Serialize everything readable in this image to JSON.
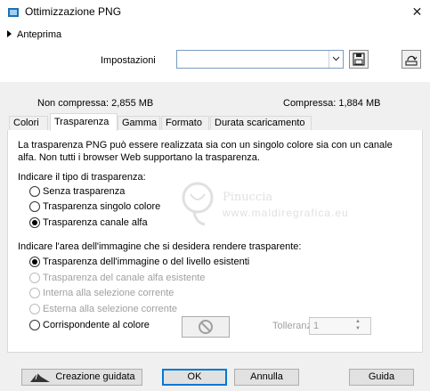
{
  "window": {
    "title": "Ottimizzazione PNG",
    "close_glyph": "✕"
  },
  "preview": {
    "label": "Anteprima"
  },
  "settings": {
    "label": "Impostazioni",
    "value": ""
  },
  "sizes": {
    "uncompressed_label": "Non compressa:",
    "uncompressed_value": "2,855 MB",
    "compressed_label": "Compressa:",
    "compressed_value": "1,884 MB"
  },
  "tabs": [
    {
      "label": "Colori"
    },
    {
      "label": "Trasparenza",
      "active": true
    },
    {
      "label": "Gamma"
    },
    {
      "label": "Formato"
    },
    {
      "label": "Durata scaricamento"
    }
  ],
  "panel": {
    "description": "La trasparenza PNG può essere realizzata sia con un singolo colore sia con un canale alfa. Non tutti i browser Web supportano la trasparenza.",
    "type_heading": "Indicare il tipo di trasparenza:",
    "type_options": [
      {
        "label": "Senza trasparenza",
        "checked": false
      },
      {
        "label": "Trasparenza singolo colore",
        "checked": false
      },
      {
        "label": "Trasparenza canale alfa",
        "checked": true
      }
    ],
    "area_heading": "Indicare l'area dell'immagine che si desidera rendere trasparente:",
    "area_options": [
      {
        "label": "Trasparenza dell'immagine o del livello esistenti",
        "checked": true,
        "enabled": true
      },
      {
        "label": "Trasparenza del canale alfa esistente",
        "checked": false,
        "enabled": false
      },
      {
        "label": "Interna alla selezione corrente",
        "checked": false,
        "enabled": false
      },
      {
        "label": "Esterna alla selezione corrente",
        "checked": false,
        "enabled": false
      },
      {
        "label": "Corrispondente al colore",
        "checked": false,
        "enabled": true
      }
    ],
    "tolerance_label": "Tolleranza",
    "tolerance_value": "1"
  },
  "watermark": {
    "name": "Pinuccia",
    "url": "www.maldiregrafica.eu"
  },
  "buttons": {
    "wizard": "Creazione guidata",
    "ok": "OK",
    "cancel": "Annulla",
    "help": "Guida"
  },
  "colors": {
    "panel_bg": "#f0f0f0",
    "accent": "#0078d7"
  }
}
